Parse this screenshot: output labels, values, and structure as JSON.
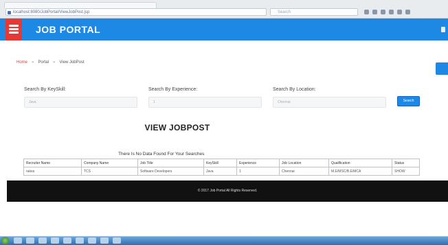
{
  "browser": {
    "address": "localhost:8080/JobPortal/ViewJobPost.jsp",
    "search_placeholder": "Search"
  },
  "header": {
    "title": "JOB PORTAL"
  },
  "breadcrumb": {
    "home": "Home",
    "section": "Portal",
    "current": "View JobPost",
    "separator": "»"
  },
  "filters": {
    "keyskill_label": "Search By KeySkill:",
    "keyskill_value": "Java",
    "experience_label": "Search By Experience:",
    "experience_value": "1",
    "location_label": "Search By Location:",
    "location_value": "Chennai",
    "search_button": "Search"
  },
  "main": {
    "title": "VIEW JOBPOST",
    "no_data_message": "There Is No Data Found For Your Searches",
    "table": {
      "headers": [
        "Recruiter Name",
        "Company Name",
        "Job Title",
        "KeySkill",
        "Experience",
        "Job Location",
        "Qualification",
        "Status"
      ],
      "rows": [
        [
          "rakes",
          "TCS",
          "Software Developers",
          "Java",
          "1",
          "Chennai",
          "M.E/MSC/B.E/MCA",
          "SHOW"
        ]
      ]
    }
  },
  "footer": {
    "text": "© 2017 Job Portal All Rights Reserved."
  },
  "colors": {
    "header_bg": "#1e88e5",
    "menu_button": "#e53935",
    "footer_bg": "#111111"
  }
}
